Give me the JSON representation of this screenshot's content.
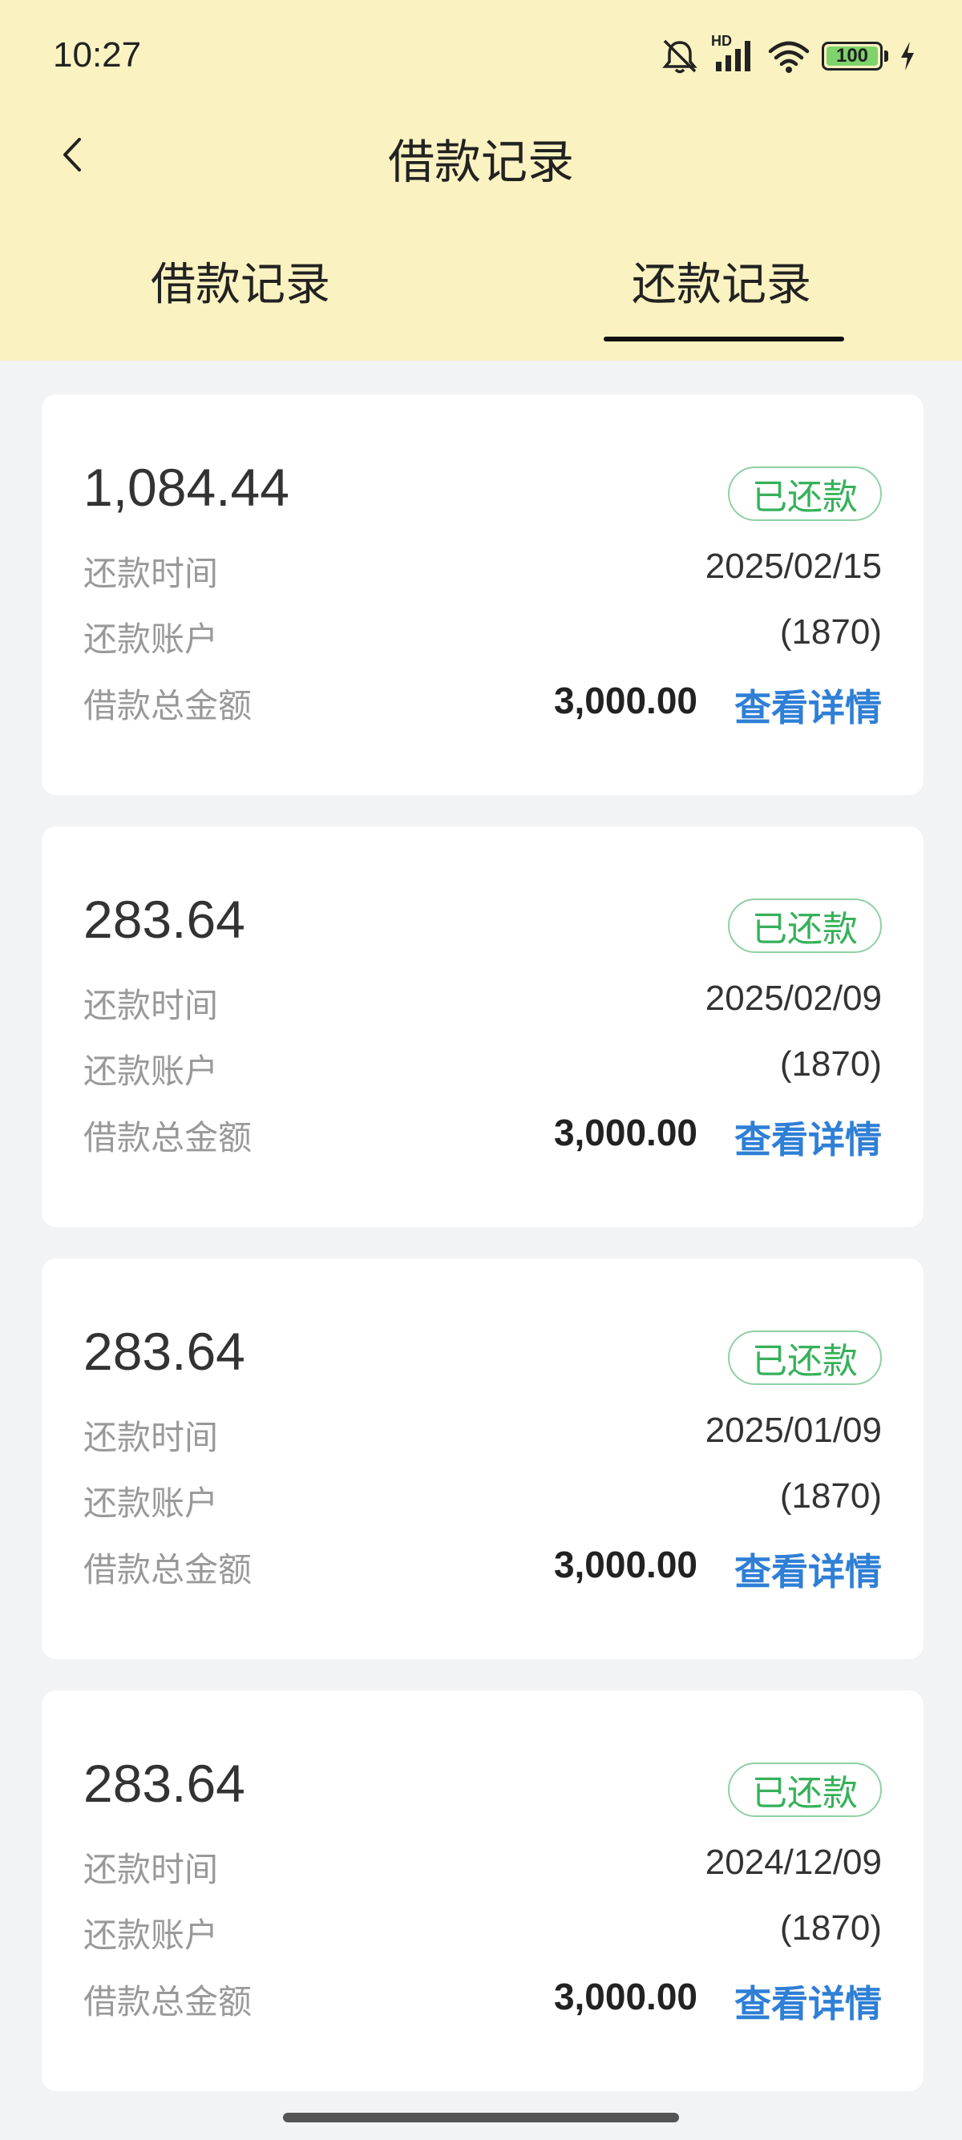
{
  "status_bar": {
    "time": "10:27",
    "network_label": "HD",
    "battery": "100",
    "battery_level_percent": 100
  },
  "nav": {
    "title": "借款记录",
    "back_icon": "chevron-left-icon"
  },
  "tabs": [
    {
      "label": "借款记录",
      "active": false
    },
    {
      "label": "还款记录",
      "active": true
    }
  ],
  "records": [
    {
      "amount": "1,084.44",
      "status": "已还款",
      "time_label": "还款时间",
      "time_value": "2025/02/15",
      "account_label": "还款账户",
      "account_value": "(1870)",
      "total_label": "借款总金额",
      "total_value": "3,000.00",
      "detail_link": "查看详情"
    },
    {
      "amount": "283.64",
      "status": "已还款",
      "time_label": "还款时间",
      "time_value": "2025/02/09",
      "account_label": "还款账户",
      "account_value": "(1870)",
      "total_label": "借款总金额",
      "total_value": "3,000.00",
      "detail_link": "查看详情"
    },
    {
      "amount": "283.64",
      "status": "已还款",
      "time_label": "还款时间",
      "time_value": "2025/01/09",
      "account_label": "还款账户",
      "account_value": "(1870)",
      "total_label": "借款总金额",
      "total_value": "3,000.00",
      "detail_link": "查看详情"
    },
    {
      "amount": "283.64",
      "status": "已还款",
      "time_label": "还款时间",
      "time_value": "2024/12/09",
      "account_label": "还款账户",
      "account_value": "(1870)",
      "total_label": "借款总金额",
      "total_value": "3,000.00",
      "detail_link": "查看详情"
    }
  ],
  "colors": {
    "header_bg": "#faf2c0",
    "page_bg": "#f2f3f5",
    "status_green": "#36b15a",
    "link_blue": "#2f7fd6"
  }
}
